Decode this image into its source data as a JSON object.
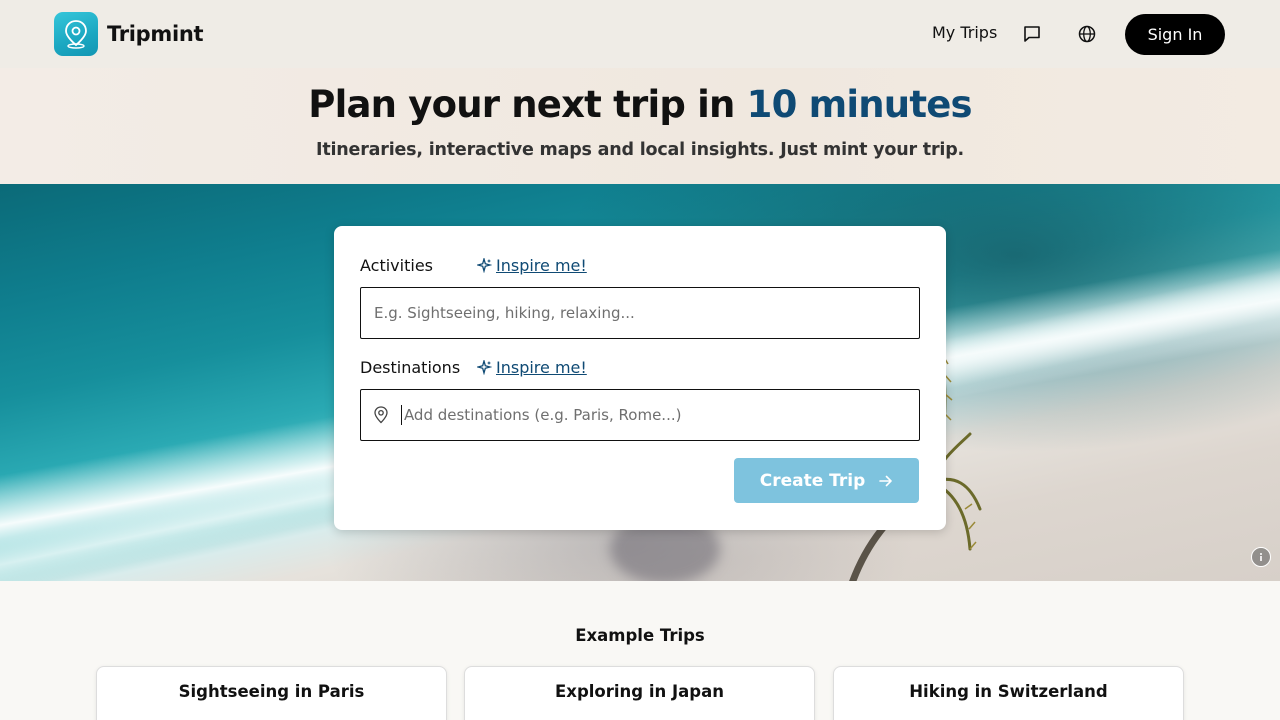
{
  "brand": {
    "name": "Tripmint"
  },
  "nav": {
    "my_trips": "My Trips",
    "sign_in": "Sign In"
  },
  "hero": {
    "title_prefix": "Plan your next trip in ",
    "title_accent": "10 minutes",
    "subtitle": "Itineraries, interactive maps and local insights. Just mint your trip."
  },
  "form": {
    "activities_label": "Activities",
    "activities_inspire": "Inspire me!",
    "activities_placeholder": "E.g. Sightseeing, hiking, relaxing...",
    "destinations_label": "Destinations",
    "destinations_inspire": "Inspire me!",
    "destinations_placeholder": "Add destinations (e.g. Paris, Rome...)",
    "create_button": "Create Trip"
  },
  "examples": {
    "title": "Example Trips",
    "items": [
      {
        "label": "Sightseeing in Paris"
      },
      {
        "label": "Exploring in Japan"
      },
      {
        "label": "Hiking in Switzerland"
      }
    ]
  },
  "colors": {
    "accent": "#0f4a74",
    "button_disabled": "#7ec3de",
    "header_bg": "#efece6",
    "logo_gradient": "#1ba7c1"
  },
  "icons": [
    "map-pin-logo-icon",
    "chat-icon",
    "globe-icon",
    "sparkle-icon",
    "location-pin-icon",
    "arrow-right-icon",
    "info-icon"
  ]
}
